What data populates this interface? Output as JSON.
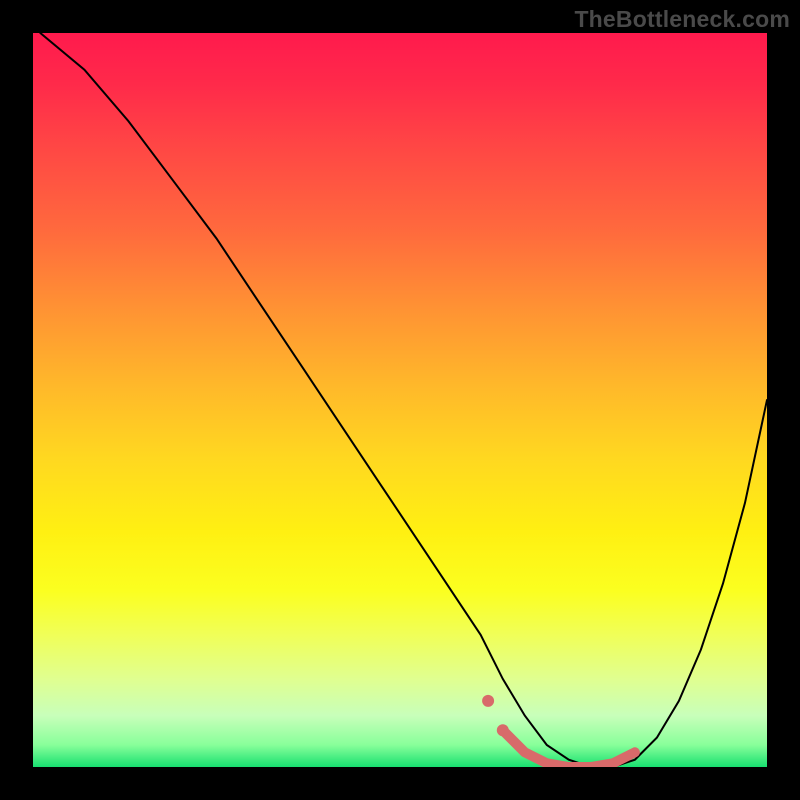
{
  "watermark": "TheBottleneck.com",
  "chart_data": {
    "type": "line",
    "title": "",
    "xlabel": "",
    "ylabel": "",
    "xlim": [
      0,
      100
    ],
    "ylim": [
      0,
      100
    ],
    "background_gradient": {
      "top_color": "#ff1a4d",
      "mid_color": "#fff012",
      "bottom_color": "#18e070"
    },
    "series": [
      {
        "name": "bottleneck-curve",
        "color": "#000000",
        "stroke_width": 2,
        "x": [
          1,
          7,
          13,
          19,
          25,
          31,
          37,
          43,
          49,
          55,
          61,
          64,
          67,
          70,
          73,
          76,
          79,
          82,
          85,
          88,
          91,
          94,
          97,
          100
        ],
        "values": [
          100,
          95,
          88,
          80,
          72,
          63,
          54,
          45,
          36,
          27,
          18,
          12,
          7,
          3,
          1,
          0,
          0,
          1,
          4,
          9,
          16,
          25,
          36,
          50
        ]
      },
      {
        "name": "optimal-range-marker",
        "color": "#d86a6a",
        "stroke_width": 10,
        "x": [
          64,
          67,
          70,
          73,
          76,
          79,
          82
        ],
        "values": [
          5,
          2,
          0.5,
          0,
          0,
          0.5,
          2
        ]
      }
    ],
    "marker_points": {
      "name": "optimal-range-dots",
      "color": "#d86a6a",
      "radius": 6,
      "points": [
        {
          "x": 62,
          "y": 9
        },
        {
          "x": 64,
          "y": 5
        }
      ]
    }
  }
}
